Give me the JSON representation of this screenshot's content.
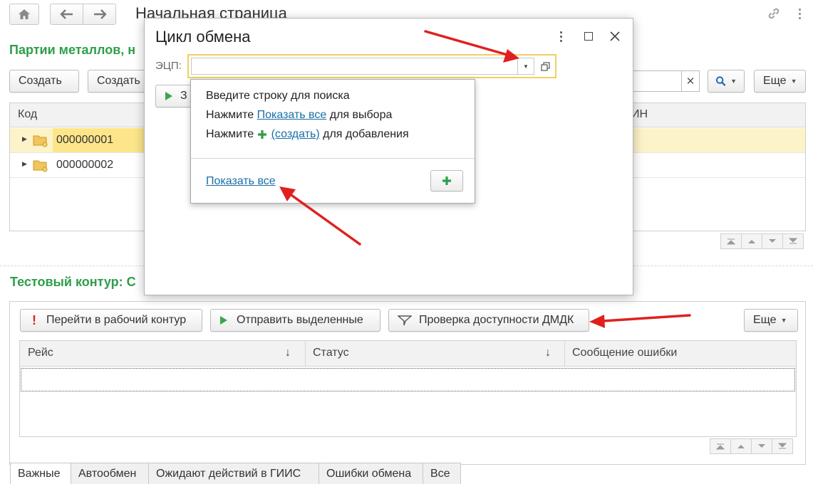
{
  "window": {
    "title": "Начальная страница"
  },
  "top": {
    "more_label": "Еще"
  },
  "section1": {
    "title": "Партии металлов, н",
    "create_label": "Создать",
    "create2_label": "Создать",
    "more_label": "Еще",
    "columns": [
      "Код",
      "ИН"
    ],
    "rows": [
      "000000001",
      "000000002"
    ]
  },
  "section2": {
    "title": "Тестовый контур: С",
    "goto_work_label": "Перейти в рабочий контур",
    "send_selected_label": "Отправить выделенные",
    "check_dmdk_label": "Проверка доступности ДМДК",
    "more_label": "Еще",
    "columns": [
      "Рейс",
      "Статус",
      "Сообщение ошибки"
    ],
    "tabs": [
      "Важные",
      "Автообмен",
      "Ожидают действий в ГИИС",
      "Ошибки обмена",
      "Все"
    ]
  },
  "dialog": {
    "title": "Цикл обмена",
    "ecp_label": "ЭЦП:",
    "ecp_value": "",
    "run_label": "З"
  },
  "popup": {
    "line1": "Введите строку для поиска",
    "line2_prefix": "Нажмите ",
    "line2_link": "Показать все",
    "line2_suffix": " для выбора",
    "line3_prefix": "Нажмите ",
    "line3_link": "(создать)",
    "line3_suffix": " для добавления",
    "show_all": "Показать все"
  },
  "colors": {
    "accent_green": "#2e9e4a",
    "selection_yellow": "#fde68a",
    "link_blue": "#1a6ea8",
    "arrow_red": "#e02020"
  }
}
